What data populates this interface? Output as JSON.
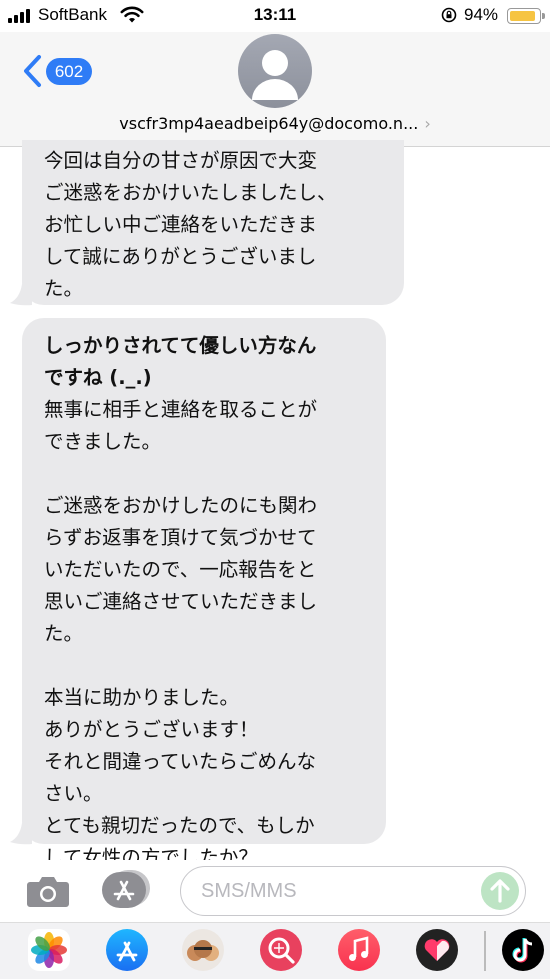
{
  "status": {
    "carrier": "SoftBank",
    "time": "13:11",
    "battery_percent": "94%",
    "battery_level": 0.94
  },
  "header": {
    "unread_badge": "602",
    "contact": "vscfr3mp4aeadbeip64y@docomo.n..."
  },
  "messages": [
    {
      "lines": [
        "今回は自分の甘さが原因で大変",
        "ご迷惑をおかけいたしましたし、",
        "お忙しい中ご連絡をいただきま",
        "して誠にありがとうございまし",
        "た。"
      ]
    },
    {
      "bold_lines": [
        "しっかりされてて優しい方なん",
        "ですね (._.)"
      ],
      "lines": [
        "無事に相手と連絡を取ることが",
        "できました。",
        "",
        "ご迷惑をおかけしたのにも関わ",
        "らずお返事を頂けて気づかせて",
        "いただいたので、一応報告をと",
        "思いご連絡させていただきまし",
        "た。",
        "",
        "本当に助かりました。",
        "ありがとうございます！",
        "それと間違っていたらごめんな",
        "さい。",
        "とても親切だったので、もしか",
        "して女性の方でしたか？"
      ]
    }
  ],
  "composer": {
    "placeholder": "SMS/MMS"
  },
  "app_drawer": [
    "photos-icon",
    "app-store-icon",
    "memoji-icon",
    "search-images-icon",
    "music-icon",
    "heart-app-icon",
    "tiktok-icon"
  ],
  "colors": {
    "badge": "#2f7cf6",
    "bubble": "#e9e9eb",
    "send_button": "#bde4c4"
  }
}
